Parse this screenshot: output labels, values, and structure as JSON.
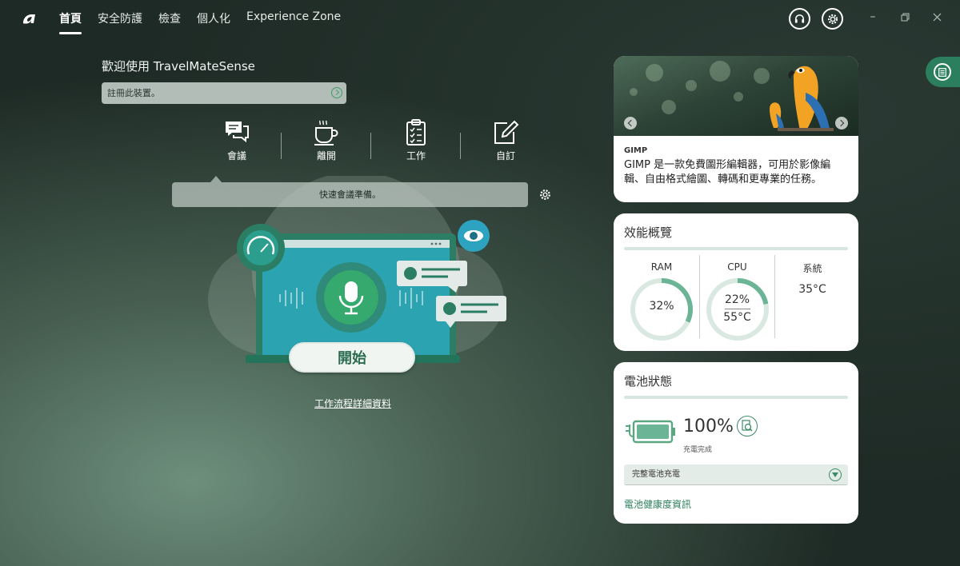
{
  "nav": {
    "items": [
      {
        "label": "首頁",
        "active": true
      },
      {
        "label": "安全防護",
        "active": false
      },
      {
        "label": "檢查",
        "active": false
      },
      {
        "label": "個人化",
        "active": false
      },
      {
        "label": "Experience Zone",
        "active": false
      }
    ]
  },
  "welcome": {
    "title": "歡迎使用 TravelMateSense",
    "register_text": "註冊此裝置。"
  },
  "modes": [
    {
      "label": "會議",
      "icon": "chat-bubbles-icon"
    },
    {
      "label": "離開",
      "icon": "coffee-cup-icon"
    },
    {
      "label": "工作",
      "icon": "clipboard-checklist-icon"
    },
    {
      "label": "自訂",
      "icon": "edit-pencil-icon"
    }
  ],
  "quick": {
    "text": "快速會議準備。"
  },
  "start_label": "開始",
  "workflow_link": "工作流程詳細資料",
  "gimp": {
    "name": "GIMP",
    "description": "GIMP 是一款免費圖形編輯器，可用於影像編輯、自由格式繪圖、轉碼和更專業的任務。"
  },
  "performance": {
    "title": "效能概覽",
    "ram": {
      "label": "RAM",
      "percent": "32%",
      "fraction": 0.32
    },
    "cpu": {
      "label": "CPU",
      "percent": "22%",
      "temp": "55°C",
      "fraction": 0.22
    },
    "system": {
      "label": "系統",
      "temp": "35°C"
    }
  },
  "battery": {
    "title": "電池狀態",
    "percent": "100%",
    "status": "充電完成",
    "mode_select": "完整電池充電",
    "health_link": "電池健康度資訊"
  },
  "colors": {
    "accent": "#2c7f5e",
    "gauge": "#6bb596",
    "gauge_track": "#d9e8e0"
  }
}
